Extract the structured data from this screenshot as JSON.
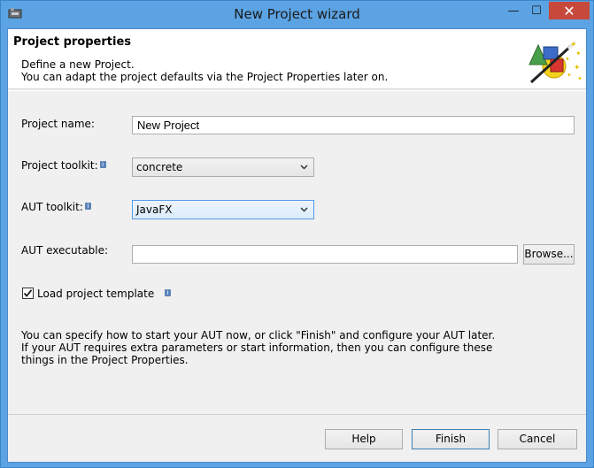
{
  "window": {
    "title": "New Project wizard",
    "minimize_glyph": "—",
    "maximize_glyph": "☐",
    "close_glyph": "✕"
  },
  "header": {
    "title": "Project properties",
    "desc_line1": "Define a new Project.",
    "desc_line2": "You can adapt the project defaults via the Project Properties later on.",
    "icon": "magic-wand-shapes-icon"
  },
  "form": {
    "project_name_label": "Project name:",
    "project_name_value": "New Project",
    "project_toolkit_label": "Project toolkit:",
    "project_toolkit_value": "concrete",
    "aut_toolkit_label": "AUT toolkit:",
    "aut_toolkit_value": "JavaFX",
    "aut_executable_label": "AUT executable:",
    "aut_executable_value": "",
    "browse_label": "Browse...",
    "load_template_label": "Load project template",
    "load_template_checked": true,
    "info_glyph": "i"
  },
  "info": {
    "line1": "You can specify how to start your AUT now, or click \"Finish\" and configure your AUT later.",
    "line2": "If your AUT requires extra parameters or start information, then you can configure these",
    "line3": "things in the Project Properties."
  },
  "buttons": {
    "help": "Help",
    "finish": "Finish",
    "cancel": "Cancel"
  },
  "colors": {
    "titlebar": "#5ba3e3",
    "close": "#c7493b",
    "dialog_bg": "#f0f0f0",
    "focus_border": "#569de5"
  }
}
